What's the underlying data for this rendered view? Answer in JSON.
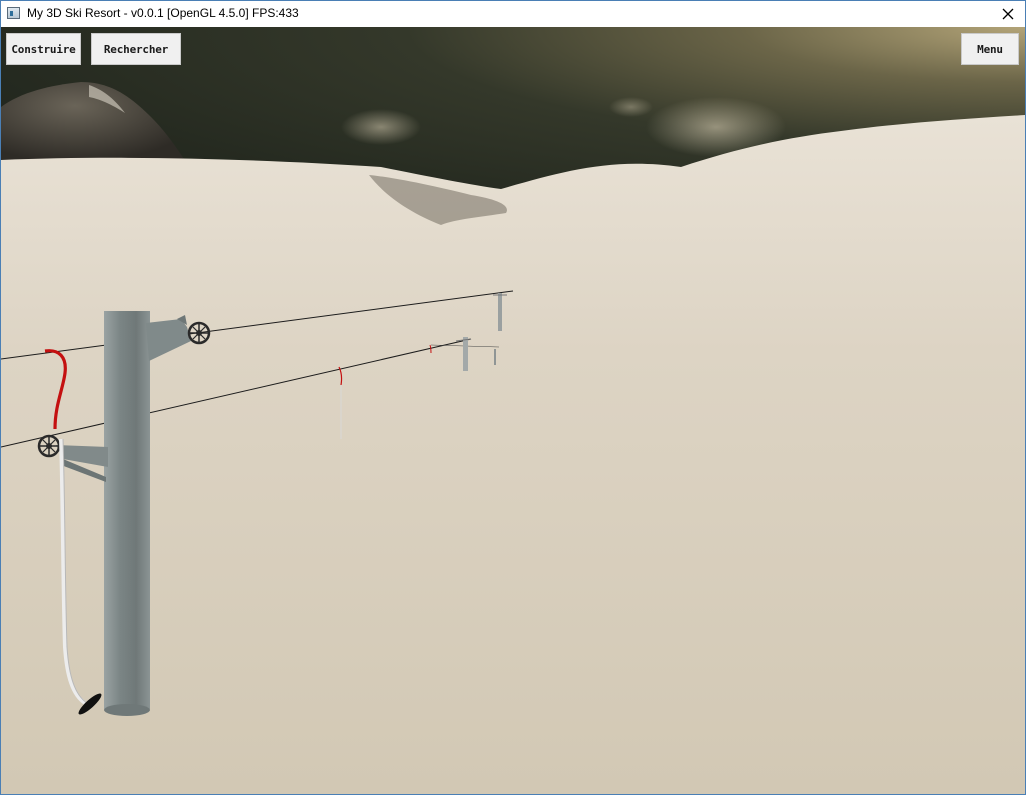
{
  "window": {
    "title": "My 3D Ski Resort - v0.0.1 [OpenGL 4.5.0] FPS:433",
    "app_icon": "window-app-icon",
    "close_icon": "close-icon"
  },
  "hud": {
    "construire_label": "Construire",
    "rechercher_label": "Rechercher",
    "menu_label": "Menu"
  },
  "scene": {
    "description_icons": [
      "mountain",
      "cloud",
      "ski-lift-pylon",
      "cable",
      "t-bar"
    ],
    "colors": {
      "sky_dark": "#262a20",
      "sky_glow": "#a89a6a",
      "snow": "#d6ccb8",
      "snow_far": "#e6dfd2",
      "pylon": "#7f8a8a",
      "tbar_red": "#c41010"
    }
  }
}
